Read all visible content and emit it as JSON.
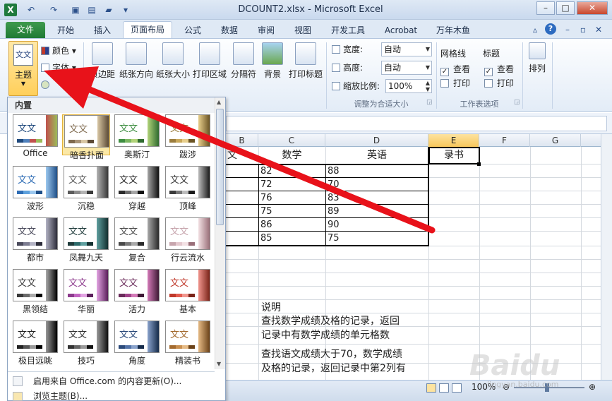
{
  "window": {
    "title": "DCOUNT2.xlsx - Microsoft Excel",
    "app_icon": "X",
    "min": "–",
    "max": "□",
    "close": "✕"
  },
  "tabs": {
    "file": "文件",
    "items": [
      "开始",
      "插入",
      "页面布局",
      "公式",
      "数据",
      "审阅",
      "视图",
      "开发工具",
      "Acrobat",
      "万年木鱼"
    ]
  },
  "ribbon": {
    "theme": "主题",
    "colors": "颜色",
    "fonts": "字体",
    "margins": "页边距",
    "orientation": "纸张方向",
    "size": "纸张大小",
    "print_area": "打印区域",
    "breaks": "分隔符",
    "background": "背景",
    "print_titles": "打印标题",
    "width_label": "宽度:",
    "width_value": "自动",
    "height_label": "高度:",
    "height_value": "自动",
    "scale_label": "缩放比例:",
    "scale_value": "100%",
    "group_scale": "调整为合适大小",
    "gridlines": "网格线",
    "headings": "标题",
    "view": "查看",
    "print": "打印",
    "group_sheet": "工作表选项",
    "arrange": "排列"
  },
  "gallery": {
    "header": "内置",
    "themes": [
      "Office",
      "暗香扑面",
      "奥斯汀",
      "跋涉",
      "波形",
      "沉稳",
      "穿越",
      "顶峰",
      "都市",
      "凤舞九天",
      "复合",
      "行云流水",
      "黑领结",
      "华丽",
      "活力",
      "基本",
      "极目远眺",
      "技巧",
      "角度",
      "精装书"
    ],
    "thumb_text": "文文",
    "footer_update": "启用来自 Office.com 的内容更新(O)...",
    "footer_browse": "浏览主题(B)..."
  },
  "sheet": {
    "columns": [
      "C",
      "D",
      "E",
      "F",
      "G"
    ],
    "b_partial": "文",
    "headers": {
      "c": "数学",
      "d": "英语",
      "e": "录书"
    },
    "rows": [
      [
        "82",
        "88"
      ],
      [
        "72",
        "70"
      ],
      [
        "76",
        "83"
      ],
      [
        "75",
        "89"
      ],
      [
        "86",
        "90"
      ],
      [
        "85",
        "75"
      ]
    ],
    "notes": [
      "说明",
      "查找数学成绩及格的记录，返回",
      "记录中有数学成绩的单元格数",
      "查找语文成绩大于70，数学成绩",
      "及格的记录，返回记录中第2列有"
    ]
  },
  "status": {
    "zoom": "100%"
  },
  "watermark": {
    "text": "Baidu",
    "sub": "jingyan.baidu.com"
  },
  "colors": {
    "arrow": "#e8121a",
    "file_tab": "#1f7a34",
    "selected_column": "#f7c75c"
  }
}
